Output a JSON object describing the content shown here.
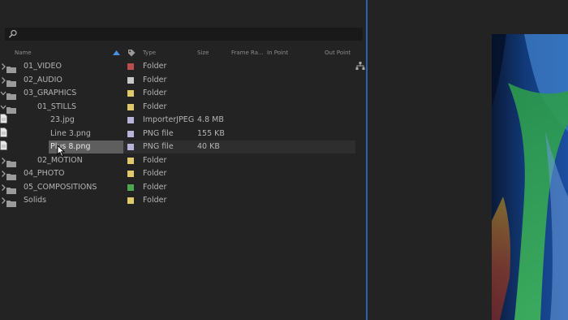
{
  "columns": {
    "name": "Name",
    "type": "Type",
    "size": "Size",
    "frame_rate": "Frame Ra...",
    "in_point": "In Point",
    "out_point": "Out Point"
  },
  "rows": [
    {
      "name": "01_VIDEO",
      "type": "Folder",
      "size": "",
      "label_color": "#b84e4e",
      "kind": "folder",
      "depth": 0,
      "expanded": false
    },
    {
      "name": "02_AUDIO",
      "type": "Folder",
      "size": "",
      "label_color": "#c8c8c8",
      "kind": "folder",
      "depth": 0,
      "expanded": false
    },
    {
      "name": "03_GRAPHICS",
      "type": "Folder",
      "size": "",
      "label_color": "#e0c96a",
      "kind": "folder",
      "depth": 0,
      "expanded": true
    },
    {
      "name": "01_STILLS",
      "type": "Folder",
      "size": "",
      "label_color": "#e0c96a",
      "kind": "folder",
      "depth": 1,
      "expanded": true
    },
    {
      "name": "23.jpg",
      "type": "ImporterJPEG",
      "size": "4.8 MB",
      "label_color": "#b8b4d8",
      "kind": "file",
      "depth": 2
    },
    {
      "name": "Line 3.png",
      "type": "PNG file",
      "size": "155 KB",
      "label_color": "#b8b4d8",
      "kind": "file",
      "depth": 2
    },
    {
      "name": "Plus 8.png",
      "type": "PNG file",
      "size": "40 KB",
      "label_color": "#b8b4d8",
      "kind": "file",
      "depth": 2,
      "selected": true
    },
    {
      "name": "02_MOTION",
      "type": "Folder",
      "size": "",
      "label_color": "#e0c96a",
      "kind": "folder",
      "depth": 1,
      "expanded": false
    },
    {
      "name": "04_PHOTO",
      "type": "Folder",
      "size": "",
      "label_color": "#e0c96a",
      "kind": "folder",
      "depth": 0,
      "expanded": false
    },
    {
      "name": "05_COMPOSITIONS",
      "type": "Folder",
      "size": "",
      "label_color": "#4fa84f",
      "kind": "folder",
      "depth": 0,
      "expanded": false
    },
    {
      "name": "Solids",
      "type": "Folder",
      "size": "",
      "label_color": "#e0c96a",
      "kind": "folder",
      "depth": 0,
      "expanded": false
    }
  ],
  "colors": {
    "accent_divider": "#2f5fae",
    "panel_bg": "#232323",
    "selected_row": "#5e5e5e"
  },
  "icons": {
    "search": "search-icon",
    "flowchart": "flowchart-icon",
    "label_header": "tag-icon",
    "sort": "sort-ascending-icon"
  }
}
